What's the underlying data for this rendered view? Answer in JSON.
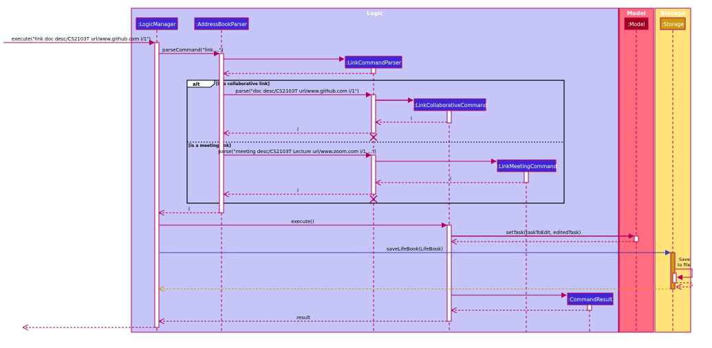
{
  "frames": {
    "logic": "Logic",
    "model": "Model",
    "storage": "Storage"
  },
  "participants": {
    "logic_manager": ":LogicManager",
    "address_book_parser": ":AddressBookParser",
    "link_command_parser": ":LinkCommandParser",
    "link_collaborative_command": "l:LinkCollaborativeCommand",
    "link_meeting_command": "l:LinkMeetingCommand",
    "model": ":Model",
    "storage": ":Storage",
    "command_result": ":CommandResult"
  },
  "messages": {
    "execute_call": "execute(\"link doc desc/CS2103T url/www.github.com i/1\")",
    "parse_command": "parseCommand(\"link ...\")",
    "parse_collab": "parse(\"doc desc/CS2103T url/www.github.com i/1\")",
    "return_collab": "l",
    "return_collab_parser": "l",
    "parse_meeting": "parse(\"meeting desc/CS2103T Lecture url/www.zoom.com i/1 ...\")",
    "return_meeting": "l",
    "return_meeting_parser": "l",
    "return_parser": "l",
    "execute": "execute()",
    "set_task": "setTask(taskToEdit, editedTask)",
    "save_life_book": "saveLifeBook(LifeBook)",
    "save_to_file_1": "Save",
    "save_to_file_2": "to file",
    "result": "result"
  },
  "fragment": {
    "operator": "alt",
    "guard_1": "[is a collaborative link]",
    "guard_2": "[is a meeting link]"
  },
  "colors": {
    "logic_bg": "#c5c5f8",
    "model_bg": "#ff6b7f",
    "storage_bg": "#ffe37a",
    "participant_logic": "#3f27d8",
    "participant_model": "#a10020",
    "participant_storage": "#c99a12",
    "arrow": "#b3005a",
    "frame_border": "#b3005a"
  }
}
